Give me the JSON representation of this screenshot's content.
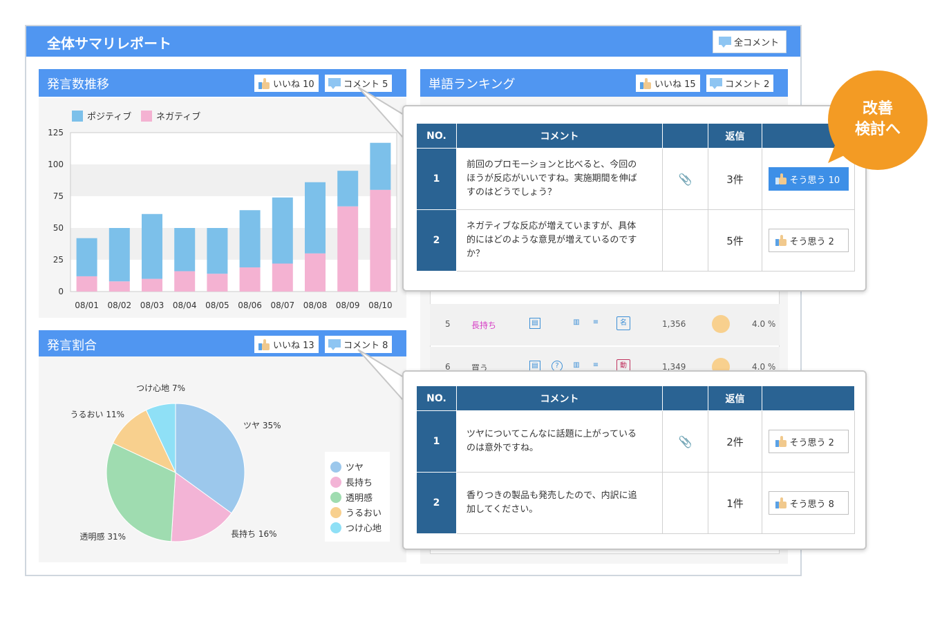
{
  "report": {
    "title": "全体サマリレポート",
    "all_comments_label": "全コメント"
  },
  "trend_panel": {
    "title": "発言数推移",
    "likes_label": "いいね 10",
    "comments_label": "コメント 5",
    "legend": [
      "ポジティブ",
      "ネガティブ"
    ]
  },
  "share_panel": {
    "title": "発言割合",
    "likes_label": "いいね 13",
    "comments_label": "コメント 8",
    "legend": [
      "ツヤ",
      "長持ち",
      "透明感",
      "うるおい",
      "つけ心地"
    ]
  },
  "ranking_panel": {
    "title": "単語ランキング",
    "likes_label": "いいね 15",
    "comments_label": "コメント 2",
    "rows": [
      {
        "rank": "5",
        "word": "長持ち",
        "tag": "名",
        "count": "1,356",
        "percent": "4.0 %"
      },
      {
        "rank": "6",
        "word": "買う",
        "tag": "動",
        "count": "1,349",
        "percent": "4.0 %"
      }
    ]
  },
  "popup_top": {
    "headers": [
      "NO.",
      "コメント",
      "",
      "返信",
      ""
    ],
    "rows": [
      {
        "no": "1",
        "comment": [
          "前回のプロモーションと比べると、今回の",
          "ほうが反応がいいですね。実施期間を伸ば",
          "すのはどうでしょう？"
        ],
        "reply": "3件",
        "agree": "そう思う 10"
      },
      {
        "no": "2",
        "comment": [
          "ネガティブな反応が増えていますが、具体",
          "的にはどのような意見が増えているのです",
          "か？"
        ],
        "reply": "5件",
        "agree": "そう思う  2"
      }
    ]
  },
  "popup_bottom": {
    "headers": [
      "NO.",
      "コメント",
      "",
      "返信",
      ""
    ],
    "rows": [
      {
        "no": "1",
        "comment": [
          "ツヤについてこんなに話題に上がっている",
          "のは意外ですね。"
        ],
        "reply": "2件",
        "agree": "そう思う 2"
      },
      {
        "no": "2",
        "comment": [
          "香りつきの製品も発売したので、内訳に追",
          "加してください。"
        ],
        "reply": "1件",
        "agree": "そう思う  8"
      }
    ]
  },
  "callout": {
    "line1": "改善",
    "line2": "検討へ"
  },
  "colors": {
    "header_blue": "#5096f1",
    "table_navy": "#2a6393",
    "positive": "#7cc0ea",
    "negative": "#f4b2d2",
    "callout_orange": "#f39b24"
  },
  "chart_data": [
    {
      "type": "bar",
      "stacked": true,
      "categories": [
        "08/01",
        "08/02",
        "08/03",
        "08/04",
        "08/05",
        "08/06",
        "08/07",
        "08/08",
        "08/09",
        "08/10"
      ],
      "series": [
        {
          "name": "ネガティブ",
          "values": [
            12,
            8,
            10,
            16,
            14,
            19,
            22,
            30,
            67,
            80
          ]
        },
        {
          "name": "ポジティブ",
          "values": [
            30,
            42,
            51,
            34,
            36,
            45,
            52,
            56,
            28,
            37
          ]
        }
      ],
      "yticks": [
        0,
        25,
        50,
        75,
        100,
        125
      ],
      "ylim": [
        0,
        125
      ],
      "legend": "top-left",
      "grid": "bands"
    },
    {
      "type": "pie",
      "slices": [
        {
          "label": "ツヤ 35%",
          "value": 35,
          "color": "#9cc8ec"
        },
        {
          "label": "長持ち 16%",
          "value": 16,
          "color": "#f3b4d6"
        },
        {
          "label": "透明感 31%",
          "value": 31,
          "color": "#9fdcb0"
        },
        {
          "label": "うるおい 11%",
          "value": 11,
          "color": "#f8d08e"
        },
        {
          "label": "つけ心地 7%",
          "value": 7,
          "color": "#8fe0f6"
        }
      ],
      "legend": "right"
    }
  ]
}
